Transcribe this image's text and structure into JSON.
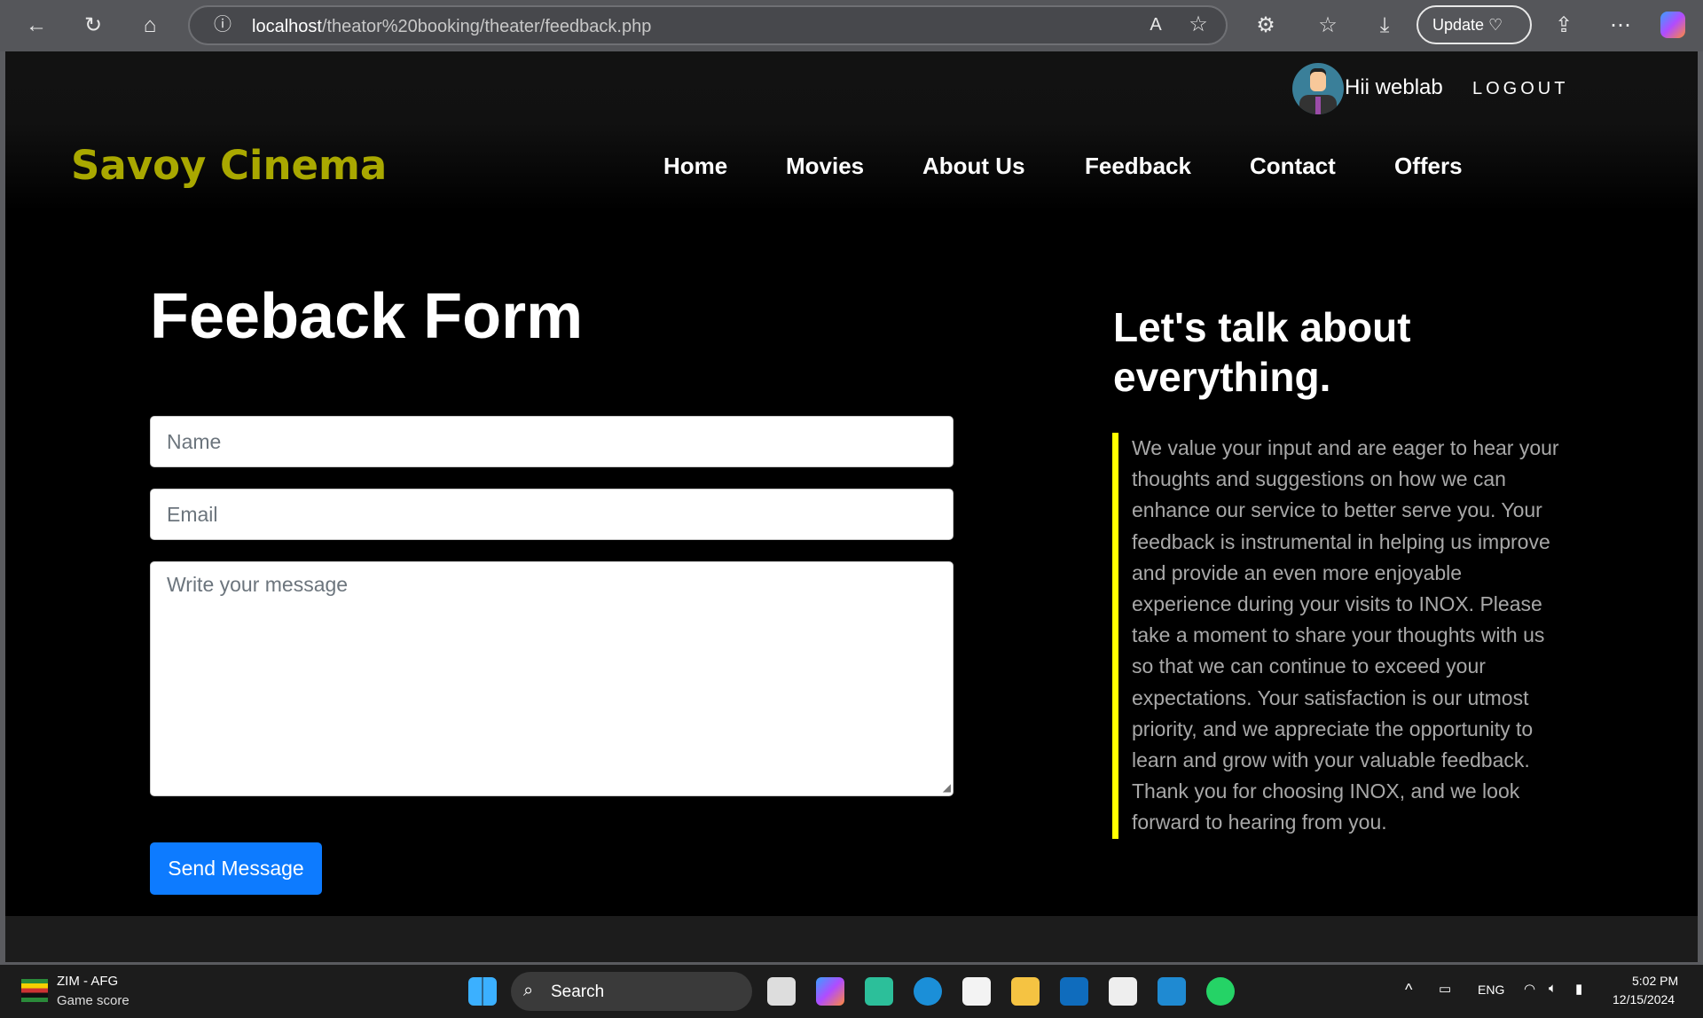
{
  "browser": {
    "url_host": "localhost",
    "url_path": "/theator%20booking/theater/feedback.php",
    "update_label": "Update"
  },
  "header": {
    "greeting": "Hii weblab",
    "logout": "LOGOUT",
    "logo": "Savoy Cinema",
    "nav": [
      "Home",
      "Movies",
      "About Us",
      "Feedback",
      "Contact",
      "Offers"
    ]
  },
  "form": {
    "title": "Feeback Form",
    "name_placeholder": "Name",
    "email_placeholder": "Email",
    "message_placeholder": "Write your message",
    "submit": "Send Message"
  },
  "aside": {
    "title": "Let's talk about everything.",
    "text": "We value your input and are eager to hear your thoughts and suggestions on how we can enhance our service to better serve you. Your feedback is instrumental in helping us improve and provide an even more enjoyable experience during your visits to INOX. Please take a moment to share your thoughts with us so that we can continue to exceed your expectations. Your satisfaction is our utmost priority, and we appreciate the opportunity to learn and grow with your valuable feedback. Thank you for choosing INOX, and we look forward to hearing from you."
  },
  "taskbar": {
    "widget_title": "ZIM - AFG",
    "widget_sub": "Game score",
    "search": "Search",
    "lang": "ENG",
    "time": "5:02 PM",
    "date": "12/15/2024"
  },
  "colors": {
    "logo": "#a9a800",
    "accent_border": "#ffff00",
    "button": "#0d7bff"
  }
}
